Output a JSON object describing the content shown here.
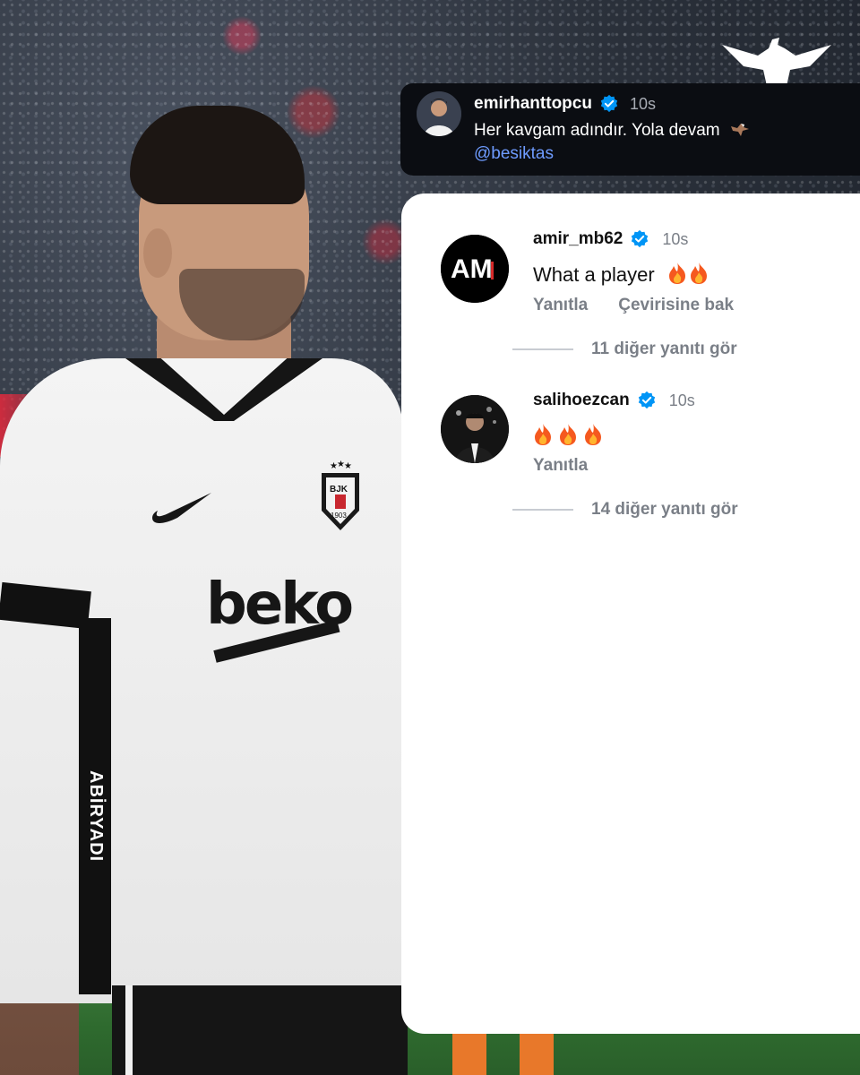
{
  "caption": {
    "username": "emirhanttopcu",
    "time": "10s",
    "text": "Her kavgam adındır. Yola devam",
    "mention": "@besiktas"
  },
  "comments": [
    {
      "username": "amir_mb62",
      "time": "10s",
      "text": "What a player",
      "reactions": [
        "fire",
        "fire"
      ],
      "avatar_text": "AM",
      "actions": [
        "Yanıtla",
        "Çevirisine bak"
      ],
      "more_replies": "11 diğer yanıtı gör"
    },
    {
      "username": "salihoezcan",
      "time": "10s",
      "text": "",
      "reactions": [
        "fire",
        "fire",
        "fire"
      ],
      "actions": [
        "Yanıtla"
      ],
      "more_replies": "14 diğer yanıtı gör"
    }
  ],
  "photo": {
    "sponsor_text": "beko",
    "crest_text": "BJK",
    "crest_year": "1903",
    "side_text": "ABİRYADI"
  },
  "colors": {
    "verified": "#0095f6",
    "mention": "#6e9bff",
    "muted": "#7a7f87",
    "caption_bg": "#0b0d12",
    "panel_bg": "#ffffff"
  },
  "icons": {
    "verified": "verified-badge-icon",
    "fire": "fire-emoji-icon",
    "eagle": "eagle-emoji-icon",
    "brand": "eagle-logo-icon"
  }
}
